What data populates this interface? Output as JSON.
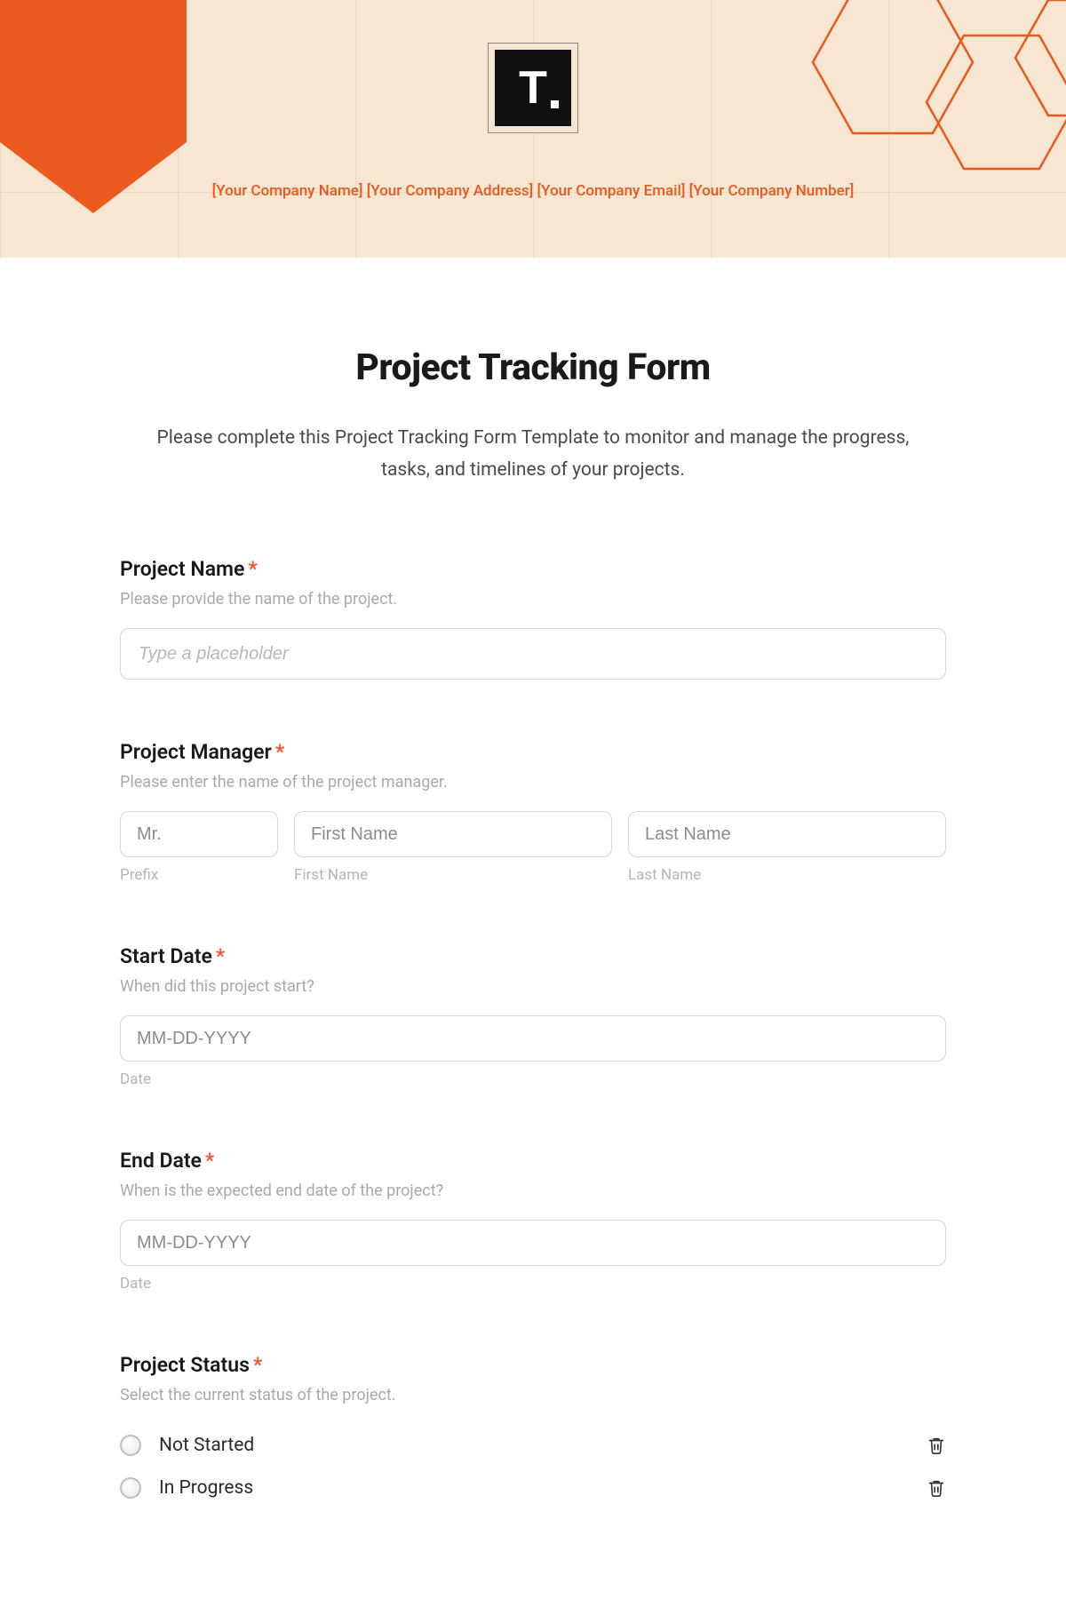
{
  "header": {
    "logo_letter": "T",
    "company_line": "[Your Company Name] [Your Company Address] [Your Company Email] [Your Company Number]"
  },
  "form": {
    "title": "Project Tracking Form",
    "intro": "Please complete this Project Tracking Form Template to monitor and manage the progress, tasks, and timelines of your projects.",
    "fields": {
      "project_name": {
        "label": "Project Name",
        "required": "*",
        "help": "Please provide the name of the project.",
        "placeholder": "Type a placeholder"
      },
      "project_manager": {
        "label": "Project Manager",
        "required": "*",
        "help": "Please enter the name of the project manager.",
        "prefix_placeholder": "Mr.",
        "first_placeholder": "First Name",
        "last_placeholder": "Last Name",
        "prefix_sub": "Prefix",
        "first_sub": "First Name",
        "last_sub": "Last Name"
      },
      "start_date": {
        "label": "Start Date",
        "required": "*",
        "help": "When did this project start?",
        "placeholder": "MM-DD-YYYY",
        "sub": "Date"
      },
      "end_date": {
        "label": "End Date",
        "required": "*",
        "help": "When is the expected end date of the project?",
        "placeholder": "MM-DD-YYYY",
        "sub": "Date"
      },
      "project_status": {
        "label": "Project Status",
        "required": "*",
        "help": "Select the current status of the project.",
        "options": [
          "Not Started",
          "In Progress"
        ]
      }
    }
  },
  "colors": {
    "accent": "#e8591c",
    "banner_bg": "#f6e6d2"
  }
}
